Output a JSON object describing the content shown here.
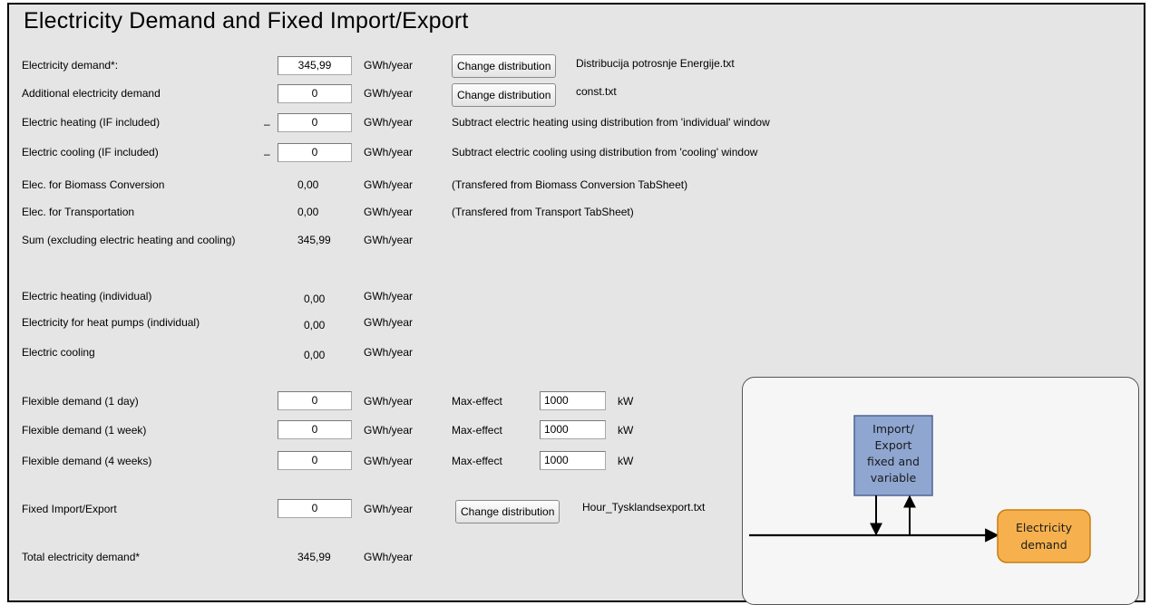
{
  "page_title": "Electricity Demand and Fixed Import/Export",
  "unit_year": "GWh/year",
  "unit_kw": "kW",
  "minus": "–",
  "rows": {
    "electricity_demand": {
      "label": "Electricity demand*:",
      "value": "345,99",
      "button": "Change distribution",
      "file": "Distribucija potrosnje Energije.txt"
    },
    "additional_demand": {
      "label": "Additional electricity demand",
      "value": "0",
      "button": "Change distribution",
      "file": "const.txt"
    },
    "electric_heating": {
      "label": "Electric heating (IF included)",
      "value": "0",
      "note": "Subtract electric heating using distribution from 'individual' window"
    },
    "electric_cooling": {
      "label": "Electric cooling (IF included)",
      "value": "0",
      "note": "Subtract electric cooling using distribution from 'cooling' window"
    },
    "biomass_conversion": {
      "label": "Elec. for Biomass Conversion",
      "value": "0,00",
      "note": "(Transfered from Biomass Conversion TabSheet)"
    },
    "transportation": {
      "label": "Elec. for Transportation",
      "value": "0,00",
      "note": "(Transfered from Transport TabSheet)"
    },
    "sum": {
      "label": "Sum (excluding electric heating and cooling)",
      "value": "345,99"
    },
    "heating_individual": {
      "label": "Electric heating (individual)",
      "value": "0,00"
    },
    "heat_pumps_individual": {
      "label": "Electricity for heat pumps (individual)",
      "value": "0,00"
    },
    "cooling": {
      "label": "Electric cooling",
      "value": "0,00"
    },
    "flex_1day": {
      "label": "Flexible demand (1 day)",
      "value": "0",
      "max_label": "Max-effect",
      "max_value": "1000"
    },
    "flex_1week": {
      "label": "Flexible demand (1 week)",
      "value": "0",
      "max_label": "Max-effect",
      "max_value": "1000"
    },
    "flex_4weeks": {
      "label": "Flexible demand (4 weeks)",
      "value": "0",
      "max_label": "Max-effect",
      "max_value": "1000"
    },
    "fixed_import_export": {
      "label": "Fixed Import/Export",
      "value": "0",
      "button": "Change distribution",
      "file": "Hour_Tysklandsexport.txt"
    },
    "total": {
      "label": "Total electricity demand*",
      "value": "345,99"
    }
  },
  "diagram": {
    "import_box": [
      "Import/",
      "Export",
      "fixed and",
      "variable"
    ],
    "demand_box": [
      "Electricity",
      "demand"
    ],
    "colors": {
      "import_fill": "#8fa6d1",
      "import_stroke": "#4f6294",
      "demand_fill": "#f6b14e",
      "demand_stroke": "#c77d12"
    }
  }
}
